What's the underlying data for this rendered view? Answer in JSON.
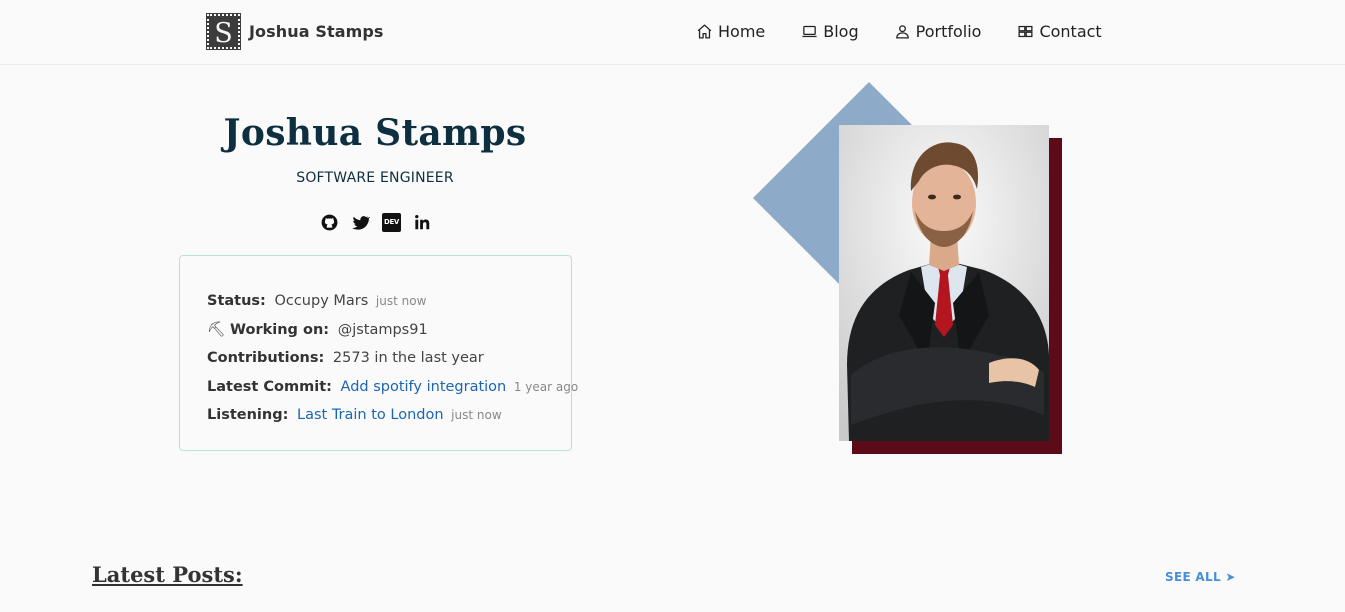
{
  "brand": {
    "logo_letter": "S",
    "name": "Joshua Stamps"
  },
  "nav": {
    "home": {
      "label": "Home",
      "icon": "home-icon"
    },
    "blog": {
      "label": "Blog",
      "icon": "laptop-icon"
    },
    "portfolio": {
      "label": "Portfolio",
      "icon": "user-icon"
    },
    "contact": {
      "label": "Contact",
      "icon": "grid-icon"
    }
  },
  "hero": {
    "name": "Joshua Stamps",
    "role": "SOFTWARE ENGINEER",
    "socials": [
      "github-icon",
      "twitter-icon",
      "dev-icon",
      "linkedin-icon"
    ],
    "dev_label": "DEV"
  },
  "status": {
    "status": {
      "label": "Status:",
      "value": "Occupy Mars",
      "time": "just now"
    },
    "working": {
      "emoji": "⛏",
      "label": "Working on:",
      "value": "@jstamps91"
    },
    "contributions": {
      "label": "Contributions:",
      "value": "2573 in the last year"
    },
    "commit": {
      "label": "Latest Commit:",
      "value": "Add spotify integration",
      "time": "1 year ago"
    },
    "listening": {
      "label": "Listening:",
      "value": "Last Train to London",
      "time": "just now"
    }
  },
  "posts": {
    "title": "Latest Posts:",
    "see_all": "SEE ALL ➤"
  },
  "colors": {
    "accent_link": "#1b66b3",
    "diamond": "#8eaac9",
    "shadow_block": "#5c0c18",
    "card_border": "#b9e3d3",
    "heading": "#0d2f3f"
  }
}
